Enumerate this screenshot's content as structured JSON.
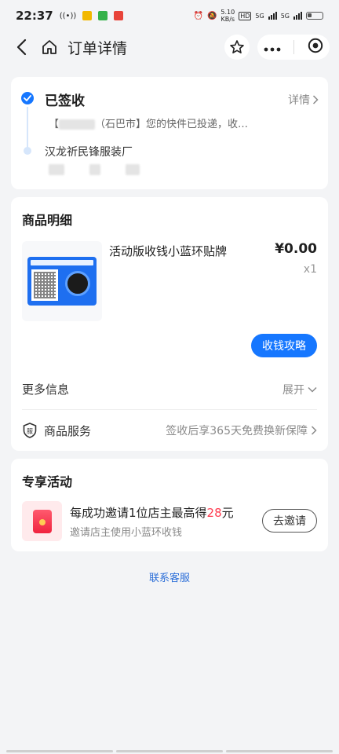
{
  "status_bar": {
    "time": "22:37",
    "net_speed_value": "5.10",
    "net_speed_unit": "KB/s",
    "signal_1": "5G",
    "signal_2": "5G",
    "hd": "HD"
  },
  "nav": {
    "title": "订单详情"
  },
  "tracking": {
    "status": "已签收",
    "detail_link": "详情",
    "message_prefix": "【",
    "message_mid": "（石巴市",
    "message_suffix": "】您的快件已投递，收…",
    "sender": "汉龙祈民锋服装厂"
  },
  "goods": {
    "section_title": "商品明细",
    "item": {
      "name": "活动版收钱小蓝环贴牌",
      "price": "¥0.00",
      "quantity": "x1"
    },
    "guide_button": "收钱攻略",
    "more_info": {
      "label": "更多信息",
      "action": "展开"
    },
    "service": {
      "icon_text": "服",
      "label": "商品服务",
      "value": "签收后享365天免费换新保障"
    }
  },
  "promo": {
    "section_title": "专享活动",
    "title_prefix": "每成功邀请1位店主最高得",
    "title_highlight": "28",
    "title_suffix": "元",
    "subtitle": "邀请店主使用小蓝环收钱",
    "button": "去邀请"
  },
  "contact": "联系客服",
  "colors": {
    "accent": "#1677ff",
    "highlight": "#ff3b4f",
    "background": "#f3f4f6"
  }
}
